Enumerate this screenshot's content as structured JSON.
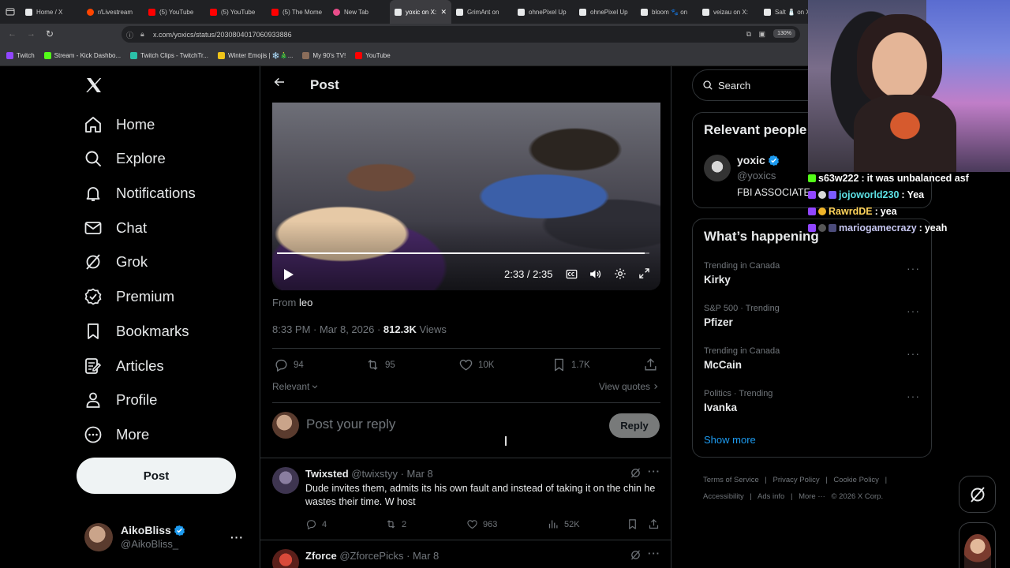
{
  "browser": {
    "tabs": [
      {
        "label": "Home / X",
        "fav": "#e7e9ea"
      },
      {
        "label": "r/Livestream",
        "fav": "#ff4500"
      },
      {
        "label": "(5) YouTube",
        "fav": "#ff0000"
      },
      {
        "label": "(5) YouTube",
        "fav": "#ff0000"
      },
      {
        "label": "(5) The Mome",
        "fav": "#ff0000"
      },
      {
        "label": "New Tab",
        "fav": "#e94d8a"
      },
      {
        "label": "yoxic on X:",
        "fav": "#e7e9ea",
        "active": true
      },
      {
        "label": "GrimAnt on",
        "fav": "#e7e9ea"
      },
      {
        "label": "ohnePixel Up",
        "fav": "#e7e9ea"
      },
      {
        "label": "ohnePixel Up",
        "fav": "#e7e9ea"
      },
      {
        "label": "bloom 🐾 on",
        "fav": "#e7e9ea"
      },
      {
        "label": "veizau on X:",
        "fav": "#e7e9ea"
      },
      {
        "label": "Salt 🧂 on X:",
        "fav": "#e7e9ea"
      }
    ],
    "url": "x.com/yoxics/status/2030804017060933886",
    "zoom": "130%",
    "bookmarks": [
      {
        "label": "Twitch",
        "fav": "#9146ff"
      },
      {
        "label": "Stream - Kick Dashbo...",
        "fav": "#53fc18"
      },
      {
        "label": "Twitch Clips - TwitchTr...",
        "fav": "#2bc0a8"
      },
      {
        "label": "Winter Emojis | ❄️🎄...",
        "fav": "#f0c419"
      },
      {
        "label": "My 90's TV!",
        "fav": "#8a6d5a"
      },
      {
        "label": "YouTube",
        "fav": "#ff0000"
      }
    ]
  },
  "nav": {
    "logo": "X",
    "items": [
      "Home",
      "Explore",
      "Notifications",
      "Chat",
      "Grok",
      "Premium",
      "Bookmarks",
      "Articles",
      "Profile",
      "More"
    ],
    "post_label": "Post",
    "user": {
      "name": "AikoBliss",
      "handle": "@AikoBliss_"
    }
  },
  "header": {
    "title": "Post"
  },
  "video": {
    "time": "2:33 / 2:35",
    "progress": 0.987
  },
  "post": {
    "from_label": "From",
    "from_user": "leo",
    "timestamp": "8:33 PM · Mar 8, 2026 · ",
    "views_count": "812.3K",
    "views_label": " Views",
    "replies": "94",
    "reposts": "95",
    "likes": "10K",
    "bookmarks": "1.7K",
    "sort_label": "Relevant",
    "view_quotes": "View quotes"
  },
  "reply_box": {
    "placeholder": "Post your reply",
    "button": "Reply"
  },
  "replies": [
    {
      "name": "Twixsted",
      "handle": "@twixstyy · Mar 8",
      "text": "Dude invites them, admits its his own fault and instead of taking it on the chin he wastes their time. W host",
      "replies": "4",
      "reposts": "2",
      "likes": "963",
      "views": "52K"
    },
    {
      "name": "Zforce",
      "handle": "@ZforcePicks · Mar 8"
    }
  ],
  "right": {
    "search_placeholder": "Search",
    "relevant_title": "Relevant people",
    "person": {
      "name": "yoxic",
      "handle": "@yoxics",
      "bio": "FBI ASSOCIATE"
    },
    "happening_title": "What’s happening",
    "trends": [
      {
        "meta": "Trending in Canada",
        "name": "Kirky"
      },
      {
        "meta": "S&P 500 · Trending",
        "name": "Pfizer"
      },
      {
        "meta": "Trending in Canada",
        "name": "McCain"
      },
      {
        "meta": "Politics · Trending",
        "name": "Ivanka"
      }
    ],
    "show_more": "Show more",
    "footer": [
      "Terms of Service",
      "Privacy Policy",
      "Cookie Policy",
      "Accessibility",
      "Ads info",
      "More ···",
      "© 2026 X Corp."
    ]
  },
  "stream_chat": [
    {
      "user": "s63w222",
      "msg": "it was unbalanced asf",
      "color": "#ffffff",
      "badge": "#53fc18"
    },
    {
      "user": "jojoworld230",
      "msg": "Yea",
      "color": "#5ce1e6",
      "badge": "#9146ff"
    },
    {
      "user": "RawrdDE",
      "msg": "yea",
      "color": "#ffd45c",
      "badge": "#9146ff"
    },
    {
      "user": "mariogamecrazy",
      "msg": "yeah",
      "color": "#c6c6f0",
      "badge": "#9146ff"
    }
  ],
  "colors": {
    "accent": "#1d9bf0",
    "verified": "#1d9bf0",
    "bg": "#000000",
    "border": "#2f3336"
  }
}
